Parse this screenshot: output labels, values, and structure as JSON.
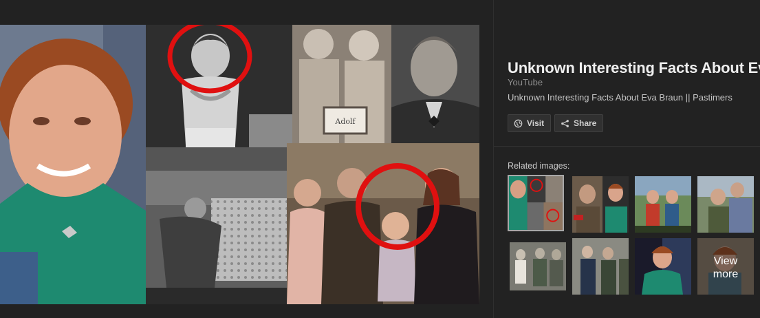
{
  "detail": {
    "title": "Unknown Interesting Facts About Eva",
    "source": "YouTube",
    "description": "Unknown Interesting Facts About Eva Braun || Pastimers",
    "visit_label": "Visit",
    "share_label": "Share"
  },
  "related": {
    "label": "Related images:",
    "view_more_line1": "View",
    "view_more_line2": "more"
  },
  "preview": {
    "sign_text": "Adolf"
  },
  "icons": {
    "visit": "globe-icon",
    "share": "share-icon"
  },
  "colors": {
    "background": "#222222",
    "accent_red": "#e01010",
    "teal_dress": "#1d8a72",
    "button_bg": "#303030"
  }
}
